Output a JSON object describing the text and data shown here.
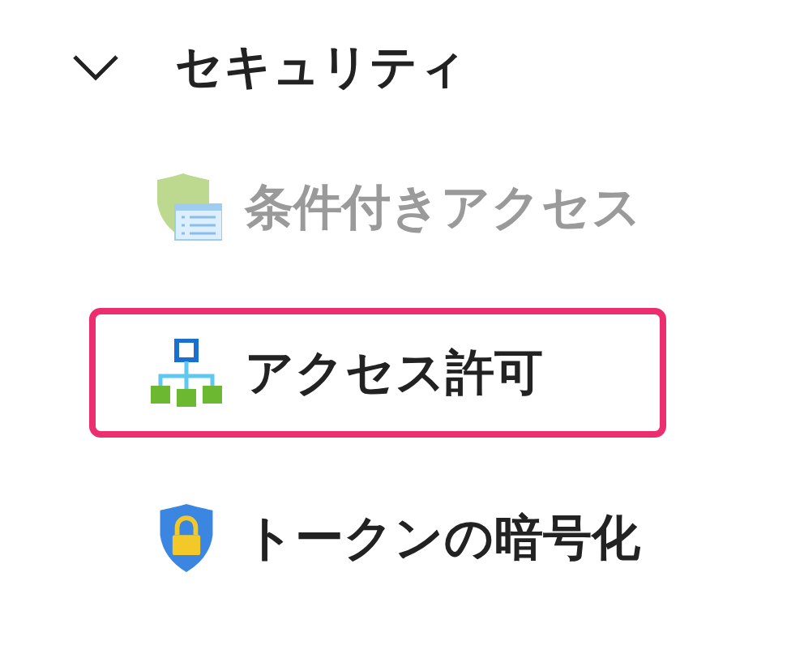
{
  "section": {
    "title": "セキュリティ",
    "expanded": true
  },
  "items": [
    {
      "label": "条件付きアクセス",
      "kind": "policy",
      "disabled": true,
      "selected": false
    },
    {
      "label": "アクセス許可",
      "kind": "hierarchy",
      "disabled": false,
      "selected": true
    },
    {
      "label": "トークンの暗号化",
      "kind": "lock",
      "disabled": false,
      "selected": false
    }
  ]
}
